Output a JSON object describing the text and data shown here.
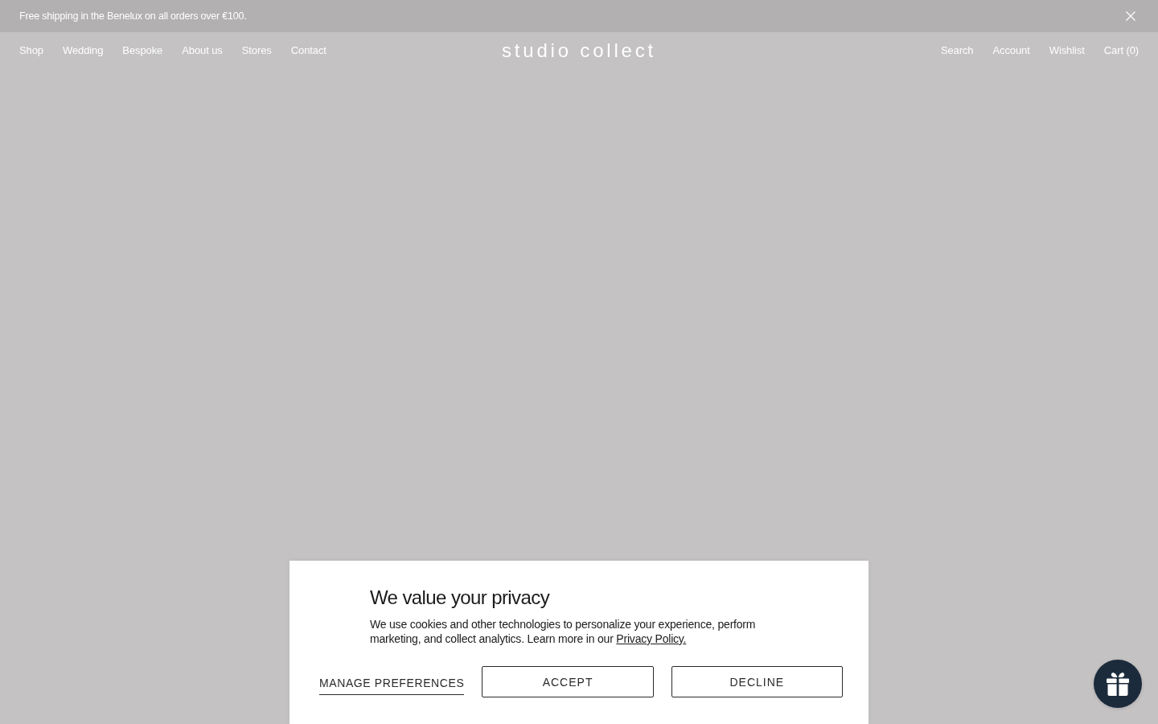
{
  "announcement": {
    "text": "Free shipping in the Benelux on all orders over €100."
  },
  "header": {
    "nav_left": [
      "Shop",
      "Wedding",
      "Bespoke",
      "About us",
      "Stores",
      "Contact"
    ],
    "logo": "studio collect",
    "nav_right": [
      "Search",
      "Account",
      "Wishlist",
      "Cart (0)"
    ]
  },
  "cookie_banner": {
    "title": "We value your privacy",
    "body": "We use cookies and other technologies to personalize your experience, perform marketing, and collect analytics. Learn more in our",
    "link": "Privacy Policy.",
    "buttons": [
      {
        "label": "MANAGE PREFERENCES",
        "kind": "link"
      },
      {
        "label": "ACCEPT",
        "kind": "outline"
      },
      {
        "label": "DECLINE",
        "kind": "outline"
      }
    ]
  }
}
